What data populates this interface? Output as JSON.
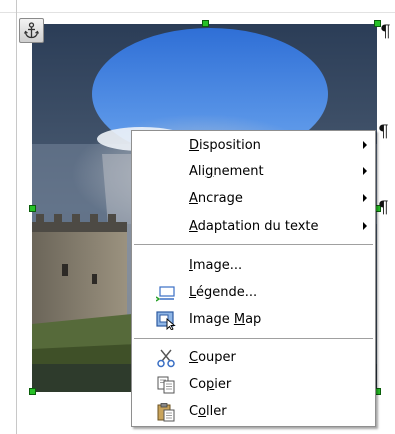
{
  "document": {
    "paragraph_mark": "¶"
  },
  "icons": {
    "anchor": "anchor-icon",
    "caption": "caption-icon",
    "imagemap": "image-map-icon",
    "cut": "scissors-icon",
    "copy": "copy-icon",
    "paste": "paste-icon"
  },
  "colors": {
    "handle": "#27c127",
    "menu_bg": "#ffffff",
    "separator": "#a0a0a0"
  },
  "context_menu": {
    "items": [
      {
        "id": "disposition",
        "pre": "",
        "mn": "D",
        "post": "isposition",
        "submenu": true
      },
      {
        "id": "alignement",
        "pre": "Ali",
        "mn": "g",
        "post": "nement",
        "submenu": true
      },
      {
        "id": "ancrage",
        "pre": "",
        "mn": "A",
        "post": "ncrage",
        "submenu": true
      },
      {
        "id": "adaptation",
        "pre": "",
        "mn": "A",
        "post": "daptation du texte",
        "submenu": true
      },
      {
        "id": "image",
        "pre": "",
        "mn": "I",
        "post": "mage...",
        "submenu": false
      },
      {
        "id": "legende",
        "pre": "",
        "mn": "L",
        "post": "égende...",
        "submenu": false
      },
      {
        "id": "imagemap",
        "pre": "Image ",
        "mn": "M",
        "post": "ap",
        "submenu": false
      },
      {
        "id": "couper",
        "pre": "",
        "mn": "C",
        "post": "ouper",
        "submenu": false
      },
      {
        "id": "copier",
        "pre": "Co",
        "mn": "p",
        "post": "ier",
        "submenu": false
      },
      {
        "id": "coller",
        "pre": "C",
        "mn": "o",
        "post": "ller",
        "submenu": false
      }
    ]
  }
}
